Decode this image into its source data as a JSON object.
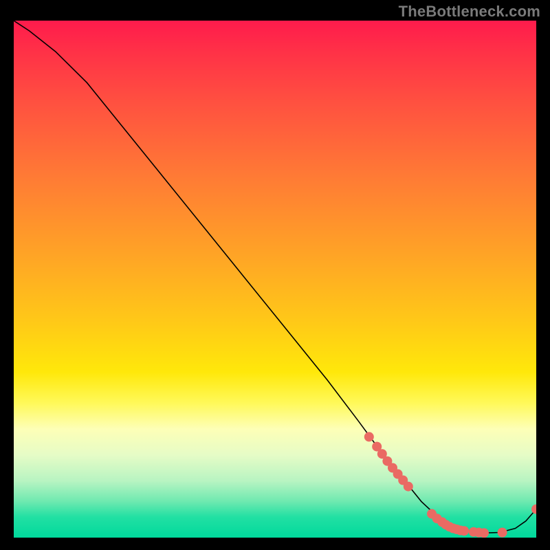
{
  "watermark": "TheBottleneck.com",
  "colors": {
    "gradient_top": "#ff1b4c",
    "gradient_mid": "#ffe80a",
    "gradient_bottom": "#00d99c",
    "curve": "#000000",
    "dots": "#ea6a63",
    "background": "#000000"
  },
  "chart_data": {
    "type": "line",
    "title": "",
    "xlabel": "",
    "ylabel": "",
    "xlim": [
      0,
      100
    ],
    "ylim": [
      0,
      100
    ],
    "grid": false,
    "legend": false,
    "series": [
      {
        "name": "curve",
        "x": [
          0,
          3,
          8,
          14,
          20,
          28,
          36,
          44,
          52,
          60,
          66,
          70,
          74,
          78,
          82,
          86,
          90,
          93,
          96,
          98,
          100
        ],
        "y": [
          100,
          98,
          94,
          88,
          80.5,
          70.5,
          60.5,
          50.5,
          40.5,
          30.5,
          22.5,
          17,
          12,
          7,
          3.2,
          1.4,
          0.9,
          1.0,
          1.8,
          3.2,
          5.5
        ]
      }
    ],
    "markers": {
      "name": "highlighted-points",
      "x": [
        68,
        69.5,
        70.5,
        71.5,
        72.5,
        73.5,
        74.5,
        75.5,
        80,
        81,
        82,
        82.7,
        83.4,
        84.1,
        84.8,
        85.5,
        86.2,
        88,
        89,
        90,
        93.5,
        100
      ],
      "y": [
        19.5,
        17.6,
        16.2,
        14.8,
        13.5,
        12.3,
        11.1,
        9.9,
        4.6,
        3.7,
        3.0,
        2.5,
        2.1,
        1.8,
        1.6,
        1.4,
        1.3,
        1.1,
        1.0,
        0.9,
        1.0,
        5.5
      ],
      "size": [
        7,
        7,
        7,
        7,
        7,
        7,
        7,
        7,
        7,
        7,
        7,
        7,
        7,
        7,
        7,
        7,
        7,
        7,
        7,
        7,
        7,
        7
      ]
    }
  }
}
